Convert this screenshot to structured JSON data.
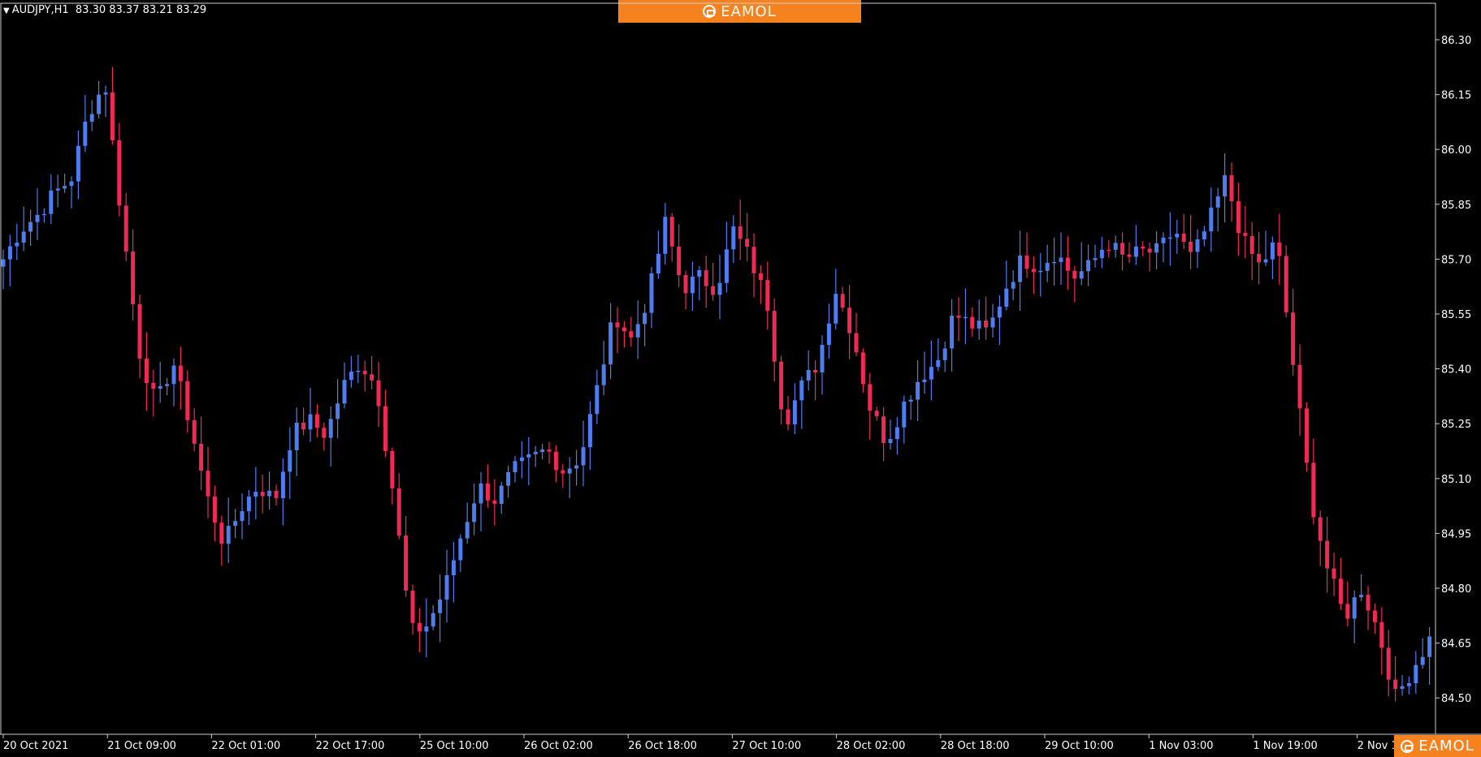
{
  "header": {
    "menu_icon": "triangle-down-icon",
    "symbol": "AUDJPY,H1",
    "ohlc": "83.30 83.37 83.21 83.29"
  },
  "brand": {
    "logo_icon": "eamol-logo-icon",
    "name": "EAMOL",
    "color": "#f5821f"
  },
  "colors": {
    "background": "#000000",
    "up": "#4f7df0",
    "down": "#ef2a55",
    "axis": "#ffffff"
  },
  "chart_data": {
    "type": "candlestick",
    "symbol": "AUDJPY",
    "timeframe": "H1",
    "ylim": [
      84.4,
      86.4
    ],
    "y_ticks": [
      86.3,
      86.15,
      86.0,
      85.85,
      85.7,
      85.55,
      85.4,
      85.25,
      85.1,
      84.95,
      84.8,
      84.65,
      84.5
    ],
    "x_ticks": [
      "20 Oct 2021",
      "21 Oct 09:00",
      "22 Oct 01:00",
      "22 Oct 17:00",
      "25 Oct 10:00",
      "26 Oct 02:00",
      "26 Oct 18:00",
      "27 Oct 10:00",
      "28 Oct 02:00",
      "28 Oct 18:00",
      "29 Oct 10:00",
      "1 Nov 03:00",
      "1 Nov 19:00",
      "2 Nov 1"
    ],
    "close_path": [
      85.7,
      85.78,
      85.82,
      85.88,
      85.92,
      86.1,
      86.18,
      85.8,
      85.45,
      85.3,
      85.42,
      85.25,
      85.05,
      84.92,
      85.02,
      85.08,
      85.04,
      85.22,
      85.26,
      85.22,
      85.35,
      85.42,
      85.35,
      85.05,
      84.68,
      84.7,
      84.8,
      84.95,
      85.08,
      85.04,
      85.12,
      85.15,
      85.18,
      85.12,
      85.16,
      85.35,
      85.55,
      85.48,
      85.6,
      85.8,
      85.62,
      85.65,
      85.62,
      85.78,
      85.7,
      85.58,
      85.25,
      85.35,
      85.42,
      85.62,
      85.5,
      85.3,
      85.2,
      85.3,
      85.38,
      85.42,
      85.55,
      85.52,
      85.5,
      85.62,
      85.7,
      85.68,
      85.72,
      85.65,
      85.68,
      85.75,
      85.7,
      85.72,
      85.72,
      85.78,
      85.7,
      85.8,
      85.92,
      85.75,
      85.68,
      85.75,
      85.4,
      85.05,
      84.85,
      84.72,
      84.8,
      84.68,
      84.5,
      84.58,
      84.66
    ]
  }
}
